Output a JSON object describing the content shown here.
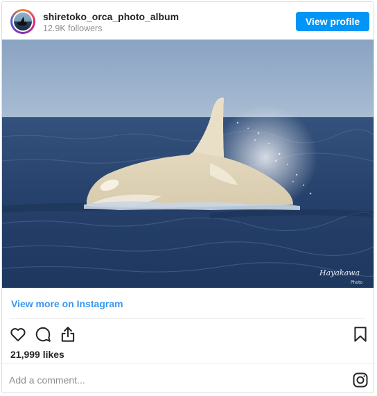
{
  "header": {
    "username": "shiretoko_orca_photo_album",
    "followers": "12.9K followers",
    "view_profile_label": "View profile"
  },
  "photo": {
    "alt": "White orca surfacing",
    "watermark": "Hayakawa",
    "watermark_sub": "Photo"
  },
  "links": {
    "view_more": "View more on Instagram"
  },
  "actions": {
    "icons": [
      "heart-icon",
      "comment-icon",
      "share-icon",
      "bookmark-icon"
    ]
  },
  "likes": "21,999 likes",
  "comment": {
    "placeholder": "Add a comment..."
  },
  "colors": {
    "accent": "#0095f6",
    "link": "#3897f0",
    "text": "#262626",
    "muted": "#8e8e8e"
  }
}
